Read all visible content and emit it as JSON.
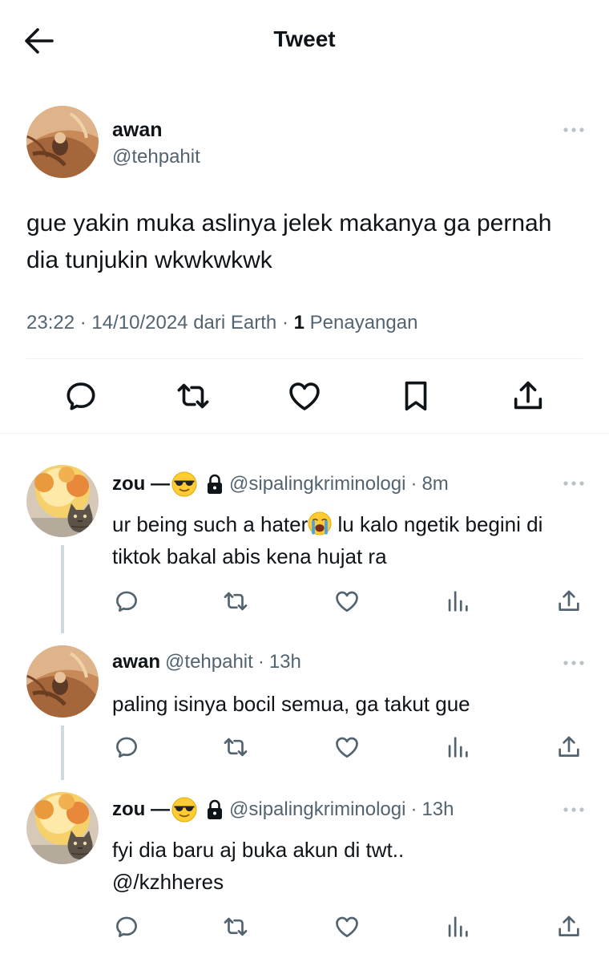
{
  "header": {
    "title": "Tweet"
  },
  "main_tweet": {
    "name": "awan",
    "handle": "@tehpahit",
    "text": "gue yakin muka aslinya jelek makanya ga pernah dia tunjukin wkwkwkwk",
    "time": "23:22",
    "date": "14/10/2024",
    "source": "dari Earth",
    "views_count": "1",
    "views_label": "Penayangan"
  },
  "replies": [
    {
      "name": "zou —",
      "handle": "@sipalingkriminologi",
      "time": "8m",
      "text_before": "ur being such a hater",
      "text_after": " lu kalo ngetik begini di tiktok bakal abis kena hujat ra"
    },
    {
      "name": "awan",
      "handle": "@tehpahit",
      "time": "13h",
      "text": "paling isinya bocil semua, ga takut gue"
    },
    {
      "name": "zou —",
      "handle": "@sipalingkriminologi",
      "time": "13h",
      "text_line1": "fyi dia baru aj buka akun di twt..",
      "text_line2": "@/kzhheres"
    }
  ],
  "separator": "·",
  "colors": {
    "text": "#0f1419",
    "secondary": "#536471",
    "divider": "#eff3f4",
    "thread": "#cfd9de"
  }
}
